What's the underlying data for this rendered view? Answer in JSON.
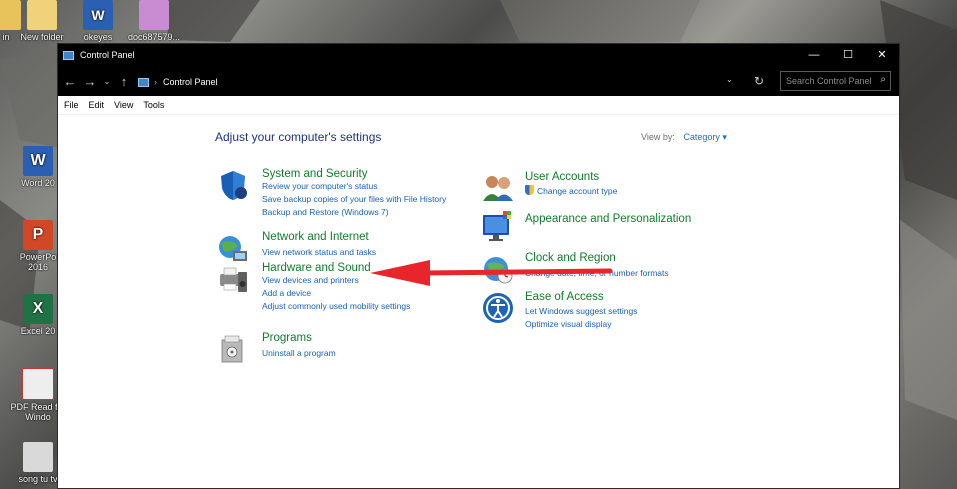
{
  "desktop": {
    "icons": [
      {
        "label": "in",
        "icon": "folder-icon"
      },
      {
        "label": "New folder",
        "icon": "folder-icon"
      },
      {
        "label": "okeyes",
        "icon": "word-doc-icon"
      },
      {
        "label": "doc687579...",
        "icon": "image-file-icon"
      },
      {
        "label": "Word 20",
        "icon": "word-app-icon"
      },
      {
        "label": "PowerPo 2016",
        "icon": "powerpoint-app-icon"
      },
      {
        "label": "Excel 20",
        "icon": "excel-app-icon"
      },
      {
        "label": "PDF Read for Windo",
        "icon": "pdf-reader-icon"
      },
      {
        "label": "song tu tv",
        "icon": "image-file-icon"
      }
    ]
  },
  "window": {
    "title": "Control Panel",
    "controls": {
      "minimize": "—",
      "maximize": "☐",
      "close": "✕"
    }
  },
  "addressbar": {
    "back": "←",
    "forward": "→",
    "recent": "⌄",
    "up": "↑",
    "separator": "›",
    "path": "Control Panel",
    "dropdown": "⌄",
    "refresh": "↻",
    "search_placeholder": "Search Control Panel",
    "search_icon": "⌕"
  },
  "menubar": {
    "items": [
      "File",
      "Edit",
      "View",
      "Tools"
    ]
  },
  "main": {
    "heading": "Adjust your computer's settings",
    "view_by_label": "View by:",
    "view_by_value": "Category",
    "view_by_arrow": "▾",
    "left_categories": [
      {
        "title": "System and Security",
        "icon": "shield-icon",
        "links": [
          "Review your computer's status",
          "Save backup copies of your files with File History",
          "Backup and Restore (Windows 7)"
        ]
      },
      {
        "title": "Network and Internet",
        "icon": "network-globe-icon",
        "links": [
          "View network status and tasks"
        ]
      },
      {
        "title": "Hardware and Sound",
        "icon": "printer-speaker-icon",
        "links": [
          "View devices and printers",
          "Add a device",
          "Adjust commonly used mobility settings"
        ]
      },
      {
        "title": "Programs",
        "icon": "programs-box-icon",
        "links": [
          "Uninstall a program"
        ]
      }
    ],
    "right_categories": [
      {
        "title": "User Accounts",
        "icon": "users-icon",
        "links": [
          "Change account type"
        ]
      },
      {
        "title": "Appearance and Personalization",
        "icon": "monitor-palette-icon",
        "links": []
      },
      {
        "title": "Clock and Region",
        "icon": "clock-globe-icon",
        "links": [
          "Change date, time, or number formats"
        ]
      },
      {
        "title": "Ease of Access",
        "icon": "ease-of-access-icon",
        "links": [
          "Let Windows suggest settings",
          "Optimize visual display"
        ]
      }
    ]
  },
  "colors": {
    "category_title": "#0e7d28",
    "link": "#1660c0",
    "heading": "#1e3287",
    "annotation_arrow": "#e8252a"
  }
}
